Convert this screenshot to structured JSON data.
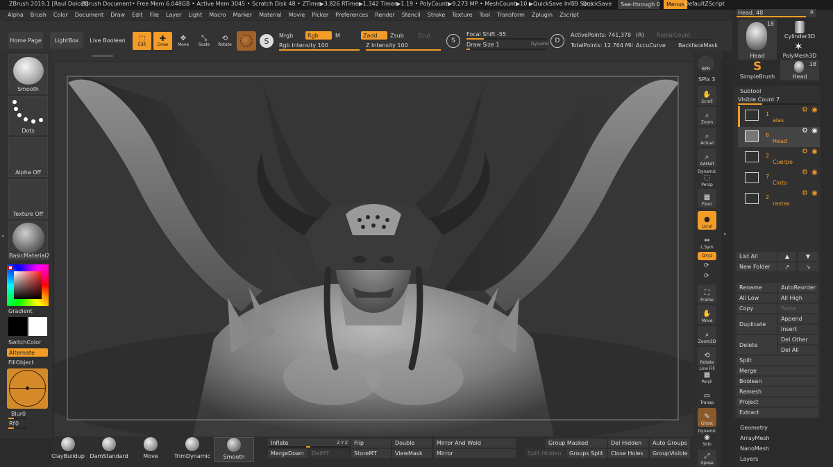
{
  "titlebar": {
    "app_title": "ZBrush 2019.1 [Raul Dolcet]",
    "doc_title": "ZBrush Document",
    "stats": "• Free Mem 6.048GB • Active Mem 3045 • Scratch Disk 48 • ZTime▶3.826 RTime▶1.342 Timer▶1.19 • PolyCount▶9.273 MP • MeshCount▶10 ▶QuickSave In 59 Secs",
    "ac": "AC",
    "quicksave": "QuickSave",
    "see_through": "See-through 0",
    "menus": "Menus",
    "default_zscript": "DefaultZScript"
  },
  "menubar": [
    "Alpha",
    "Brush",
    "Color",
    "Document",
    "Draw",
    "Edit",
    "File",
    "Layer",
    "Light",
    "Macro",
    "Marker",
    "Material",
    "Movie",
    "Picker",
    "Preferences",
    "Render",
    "Stencil",
    "Stroke",
    "Texture",
    "Tool",
    "Transform",
    "Zplugin",
    "Zscript"
  ],
  "topshelf": {
    "home_page": "Home Page",
    "lightbox": "LightBox",
    "live_boolean": "Live Boolean",
    "edit": "Edit",
    "draw": "Draw",
    "move": "Move",
    "scale": "Scale",
    "rotate": "Rotate",
    "mrgb": "Mrgb",
    "rgb": "Rgb",
    "m": "M",
    "rgb_intensity": "Rgb Intensity 100",
    "zadd": "Zadd",
    "zsub": "Zsub",
    "zcut": "Zcut",
    "z_intensity": "Z Intensity 100",
    "focal_shift": "Focal Shift -55",
    "draw_size": "Draw Size 1",
    "dynamic": "Dynamic",
    "active_points": "ActivePoints: 741,378",
    "total_points": "TotalPoints: 12.764 Mil",
    "r": "(R)",
    "radial_count": "RadialCount",
    "accucurve": "AccuCurve",
    "backface_mask": "BackfaceMask",
    "s_icon_label": "S",
    "d_icon_label": "D"
  },
  "leftshelf": {
    "smooth": "Smooth",
    "dots": "Dots",
    "alpha_off": "Alpha Off",
    "texture_off": "Texture Off",
    "material": "BasicMaterial2",
    "gradient": "Gradient",
    "switch_color": "SwitchColor",
    "alternate": "Alternate",
    "fill_object": "FillObject",
    "blur": "Blur",
    "blur_value": "0",
    "rf": "Rf",
    "rf_value": "0"
  },
  "rightshelf": {
    "bpr": "BPR",
    "spix": "SPix 3",
    "scroll": "Scroll",
    "zoom": "Zoom",
    "actual": "Actual",
    "aahalf": "AAHalf",
    "dynamic": "Dynamic",
    "persp": "Persp",
    "floor": "Floor",
    "local": "Local",
    "lsym": "L.Sym",
    "xyz": "Qxyz",
    "frame": "Frame",
    "move": "Move",
    "zoom3d": "Zoom3D",
    "rotate": "Rotate",
    "line_fill": "Line Fill",
    "polyf": "PolyF",
    "transp": "Transp",
    "ghost": "Ghost",
    "dynamic2": "Dynamic",
    "solo": "Solo",
    "xpose": "Xpose"
  },
  "toolpalette": {
    "head_slider": "Head. 48",
    "head_slider_r": "R",
    "tools": [
      {
        "name": "Head",
        "count": "18"
      },
      {
        "name": "Cylinder3D",
        "count": ""
      },
      {
        "name": "PolyMesh3D",
        "count": ""
      },
      {
        "name": "SimpleBrush",
        "count": ""
      },
      {
        "name": "Head",
        "count": "18"
      }
    ],
    "subtool_title": "Subtool",
    "visible_count": "Visible Count 7",
    "subtools": [
      {
        "num": "1",
        "name": "alas"
      },
      {
        "num": "6",
        "name": "Head"
      },
      {
        "num": "2",
        "name": "Cuerpo"
      },
      {
        "num": "7",
        "name": "Cinto"
      },
      {
        "num": "2",
        "name": "rastas"
      }
    ],
    "list_all": "List All",
    "new_folder": "New Folder",
    "rename": "Rename",
    "auto_reorder": "AutoReorder",
    "all_low": "All Low",
    "all_high": "All High",
    "copy": "Copy",
    "paste": "Paste",
    "duplicate": "Duplicate",
    "append": "Append",
    "insert": "Insert",
    "delete": "Delete",
    "del_other": "Del Other",
    "del_all": "Del All",
    "split": "Split",
    "merge": "Merge",
    "boolean": "Boolean",
    "remesh": "Remesh",
    "project": "Project",
    "extract": "Extract",
    "geometry": "Geometry",
    "arraymesh": "ArrayMesh",
    "nanomesh": "NanoMesh",
    "layers": "Layers"
  },
  "bottomshelf": {
    "brushes": [
      "ClayBuildup",
      "DamStandard",
      "Move",
      "TrimDynamic",
      "Smooth"
    ],
    "inflate": "Inflate",
    "inflate_suffix": "Z Y Z",
    "merge_down": "MergeDown",
    "del_mt": "DelMT",
    "flip": "Flip",
    "store_mt": "StoreMT",
    "double": "Double",
    "view_mask": "ViewMask",
    "mirror_and_weld": "Mirror And Weld",
    "mirror": "Mirror",
    "group_masked": "Group Masked",
    "split_hidden": "Split Hidden",
    "groups_split": "Groups Split",
    "del_hidden": "Del Hidden",
    "close_holes": "Close Holes",
    "auto_groups": "Auto Groups",
    "group_visible": "GroupVisible"
  },
  "colors": {
    "accent": "#f39c27",
    "panel": "#333333",
    "viewport": "#353535"
  }
}
